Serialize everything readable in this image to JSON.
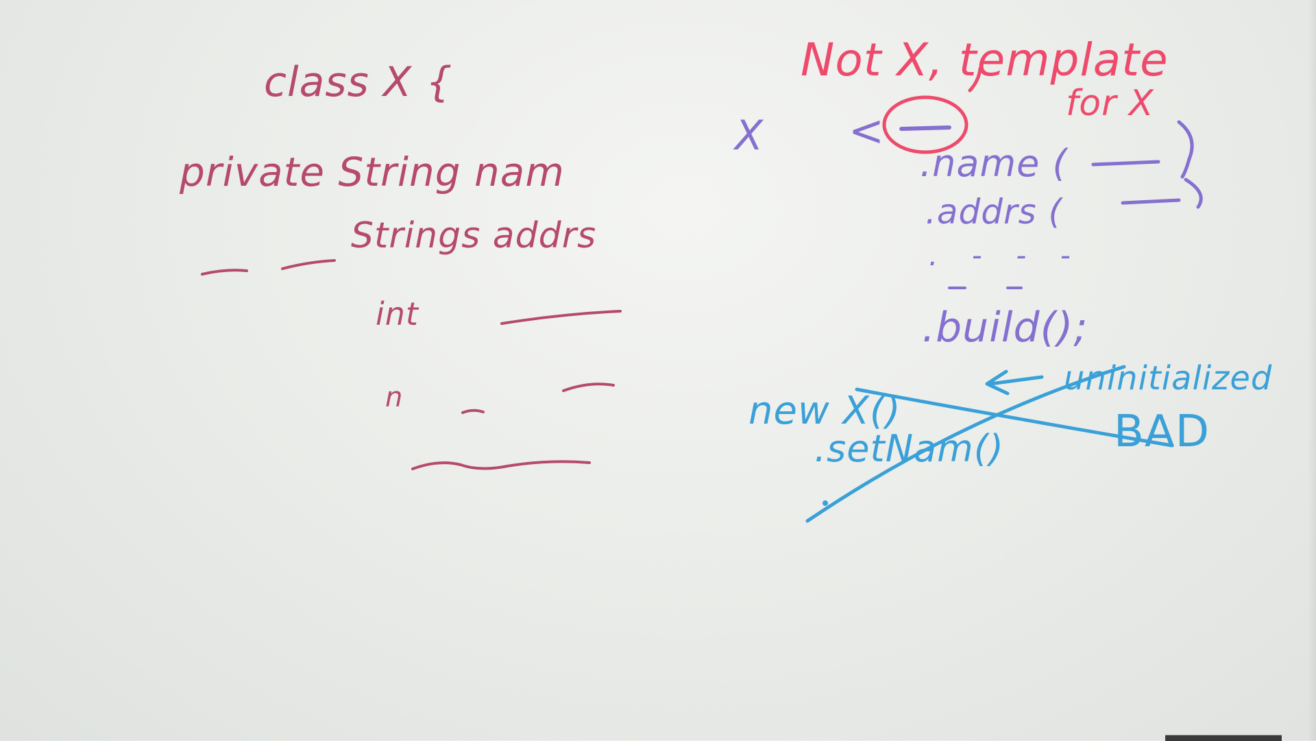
{
  "left": {
    "line1": "class X {",
    "line2": "private String nam",
    "line3": "Strings addrs",
    "line4": "int",
    "line5": "n"
  },
  "right": {
    "note_line1": "Not X, template",
    "note_line2": "for X",
    "x_label": "X",
    "angle": "<",
    "call1": ".name (",
    "call2": ".addrs (",
    "dots": ". - - -",
    "call3": ".build();",
    "uninit": "uninitialized",
    "new_x": "new X()",
    "set_nam": ".setNam()",
    "bad": "BAD"
  },
  "colors": {
    "maroon": "#b64a6c",
    "pink": "#ee4a6c",
    "violet": "#8570d0",
    "blue": "#3aa0d8"
  }
}
